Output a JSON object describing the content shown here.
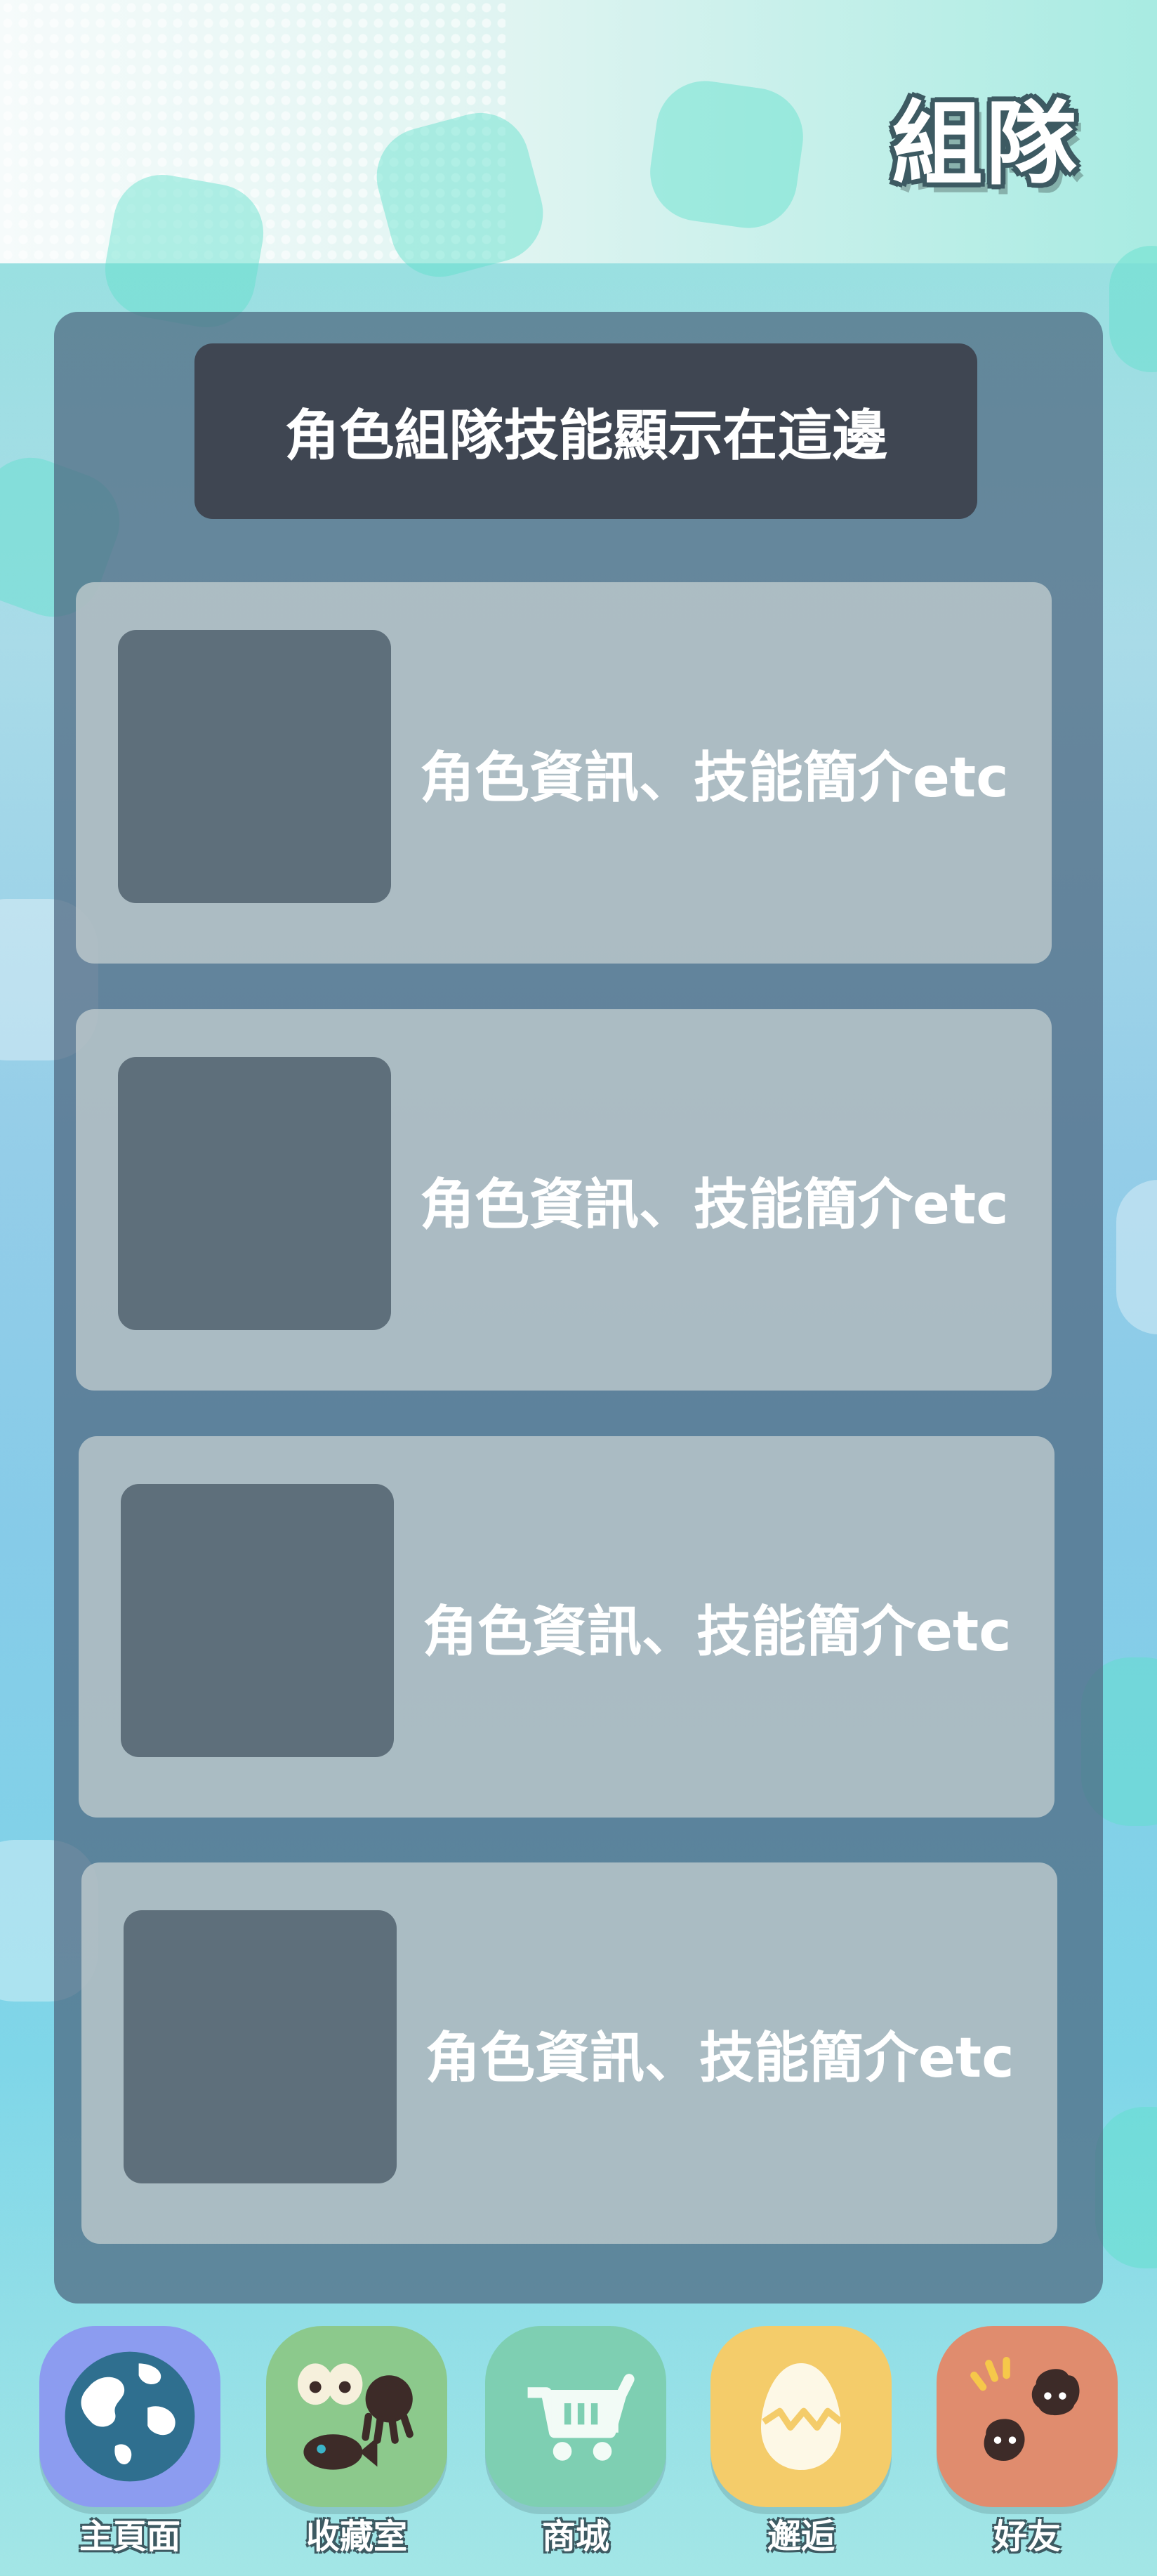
{
  "header": {
    "title": "組隊"
  },
  "banner": {
    "text": "角色組隊技能顯示在這邊"
  },
  "cards": [
    {
      "text": "角色資訊、技能簡介etc"
    },
    {
      "text": "角色資訊、技能簡介etc"
    },
    {
      "text": "角色資訊、技能簡介etc"
    },
    {
      "text": "角色資訊、技能簡介etc"
    }
  ],
  "nav": {
    "items": [
      {
        "label": "主頁面",
        "icon": "globe-icon",
        "color": "#8c9cf0"
      },
      {
        "label": "收藏室",
        "icon": "collection-creatures-icon",
        "color": "#8cc98c"
      },
      {
        "label": "商城",
        "icon": "shopping-cart-icon",
        "color": "#7ecfb2"
      },
      {
        "label": "邂逅",
        "icon": "cracked-egg-icon",
        "color": "#f4cc6a"
      },
      {
        "label": "好友",
        "icon": "friends-icon",
        "color": "#e08c6e"
      }
    ]
  }
}
